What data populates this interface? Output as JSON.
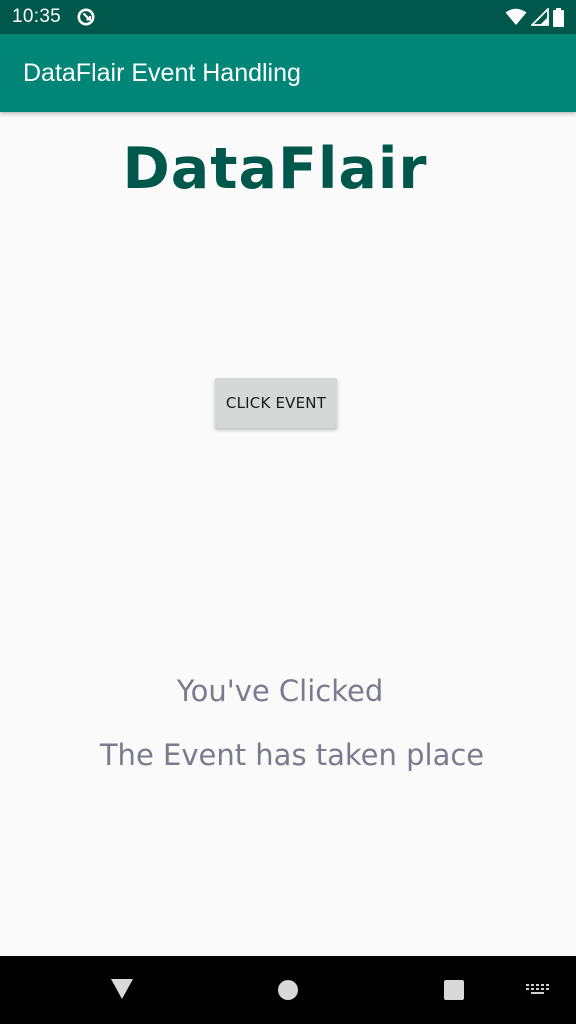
{
  "status_bar": {
    "time": "10:35",
    "background": "#00574b",
    "icons": [
      "data-saver-icon",
      "wifi-icon",
      "signal-icon",
      "battery-icon"
    ]
  },
  "app_bar": {
    "title": "DataFlair Event Handling",
    "background": "#008577"
  },
  "main": {
    "brand_title": "DataFlair",
    "brand_color": "#00574b",
    "button_label": "CLICK EVENT",
    "message_line_1": "You've Clicked",
    "message_line_2": "The Event has taken place",
    "message_color": "#7a7b8e"
  },
  "nav_bar": {
    "buttons": [
      "back-icon",
      "home-icon",
      "recents-icon",
      "keyboard-icon"
    ]
  }
}
